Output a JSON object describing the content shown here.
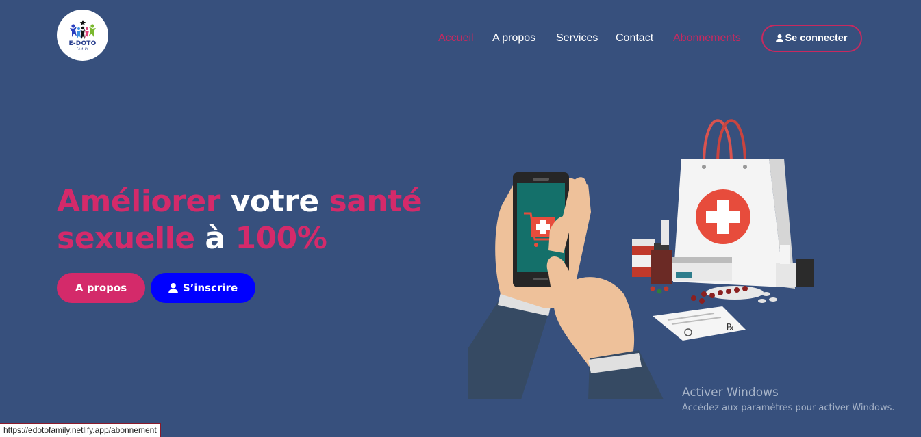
{
  "logo": {
    "name": "E-DOTO",
    "sub": "FAMILY"
  },
  "nav": {
    "items": [
      {
        "label": "Accueil",
        "state": "active"
      },
      {
        "label": "A propos",
        "state": "normal"
      },
      {
        "label": "Services",
        "state": "normal"
      },
      {
        "label": "Contact",
        "state": "normal"
      },
      {
        "label": "Abonnements",
        "state": "hover"
      }
    ],
    "login_label": "Se connecter",
    "login_icon": "user-icon"
  },
  "hero": {
    "title_parts": [
      {
        "text": "Améliorer",
        "color": "#d42a6a"
      },
      {
        "text": "votre",
        "color": "#ffffff"
      },
      {
        "text": "santé",
        "color": "#d42a6a"
      },
      {
        "text": "sexuelle",
        "color": "#d42a6a"
      },
      {
        "text": "à",
        "color": "#ffffff"
      },
      {
        "text": "100%",
        "color": "#d42a6a"
      }
    ],
    "btn_about": "A propos",
    "btn_signup": "S’inscrire",
    "btn_signup_icon": "user-icon"
  },
  "illustration": {
    "icon": "pharmacy-shopping-illustration"
  },
  "watermark": {
    "title": "Activer Windows",
    "subtitle": "Accédez aux paramètres pour activer Windows."
  },
  "status_bar": {
    "url": "https://edotofamily.netlify.app/abonnement"
  },
  "colors": {
    "background": "#37507d",
    "accent_pink": "#d42a6a",
    "accent_blue": "#0000ff",
    "nav_active": "#c8295f"
  }
}
